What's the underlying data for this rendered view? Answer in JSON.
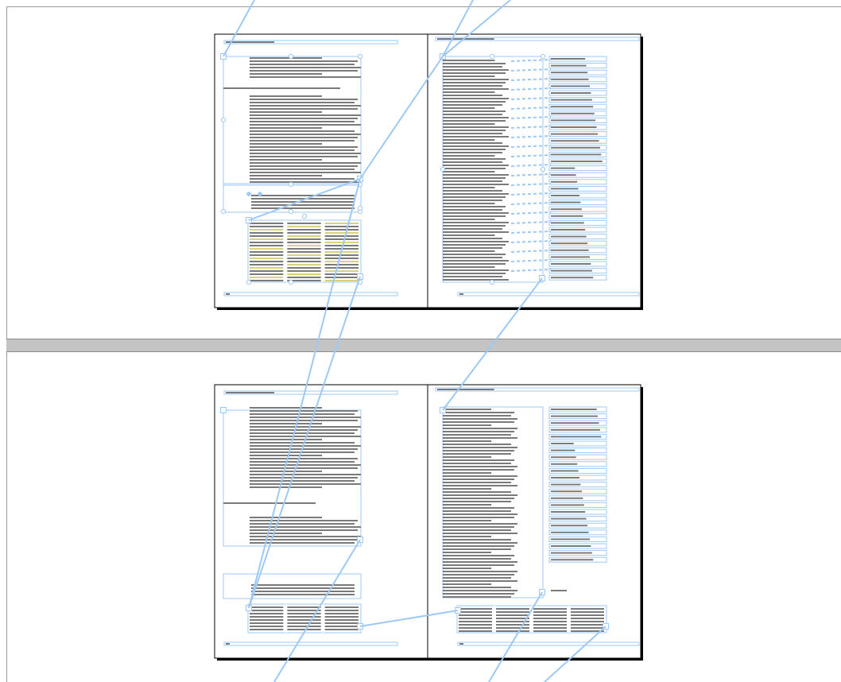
{
  "window": {
    "title": ""
  },
  "colors": {
    "frame": "#9ec9f5",
    "thread": "#9ec9f5",
    "text_line": "#7a7a7a",
    "table_highlight": "#d9d27a",
    "page_border": "#000000",
    "divider": "#c4c4c4"
  },
  "views": [
    {
      "name": "upper-spread",
      "layout": "spread-with-sidebar-notes"
    },
    {
      "name": "lower-spread",
      "layout": "spread-with-sidebar-notes"
    }
  ]
}
